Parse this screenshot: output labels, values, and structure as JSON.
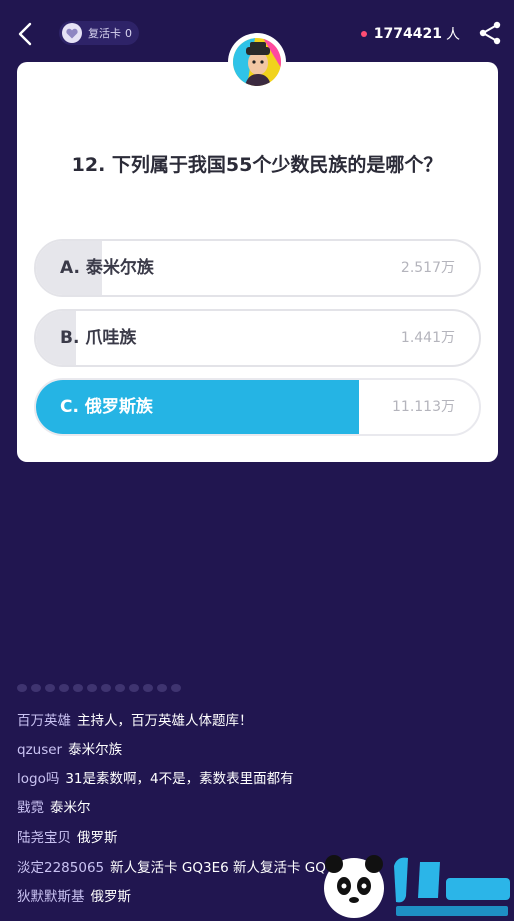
{
  "header": {
    "revive_label": "复活卡",
    "revive_count": "0",
    "online_count": "1774421",
    "online_unit": "人",
    "icons": {
      "back": "back-arrow-icon",
      "heart": "heart-icon",
      "share": "share-icon"
    }
  },
  "question": {
    "text": "12. 下列属于我国55个少数民族的是哪个？"
  },
  "options": [
    {
      "label": "A. 泰米尔族",
      "votes": "2.517万",
      "fill": 0.15,
      "selected": false
    },
    {
      "label": "B. 爪哇族",
      "votes": "1.441万",
      "fill": 0.09,
      "selected": false
    },
    {
      "label": "C. 俄罗斯族",
      "votes": "11.113万",
      "fill": 0.73,
      "selected": true
    }
  ],
  "comments": [
    {
      "user": "百万英雄",
      "text": "主持人，百万英雄人体题库！"
    },
    {
      "user": "qzuser",
      "text": "泰米尔族"
    },
    {
      "user": "logo吗",
      "text": "31是素数啊，4不是，素数表里面都有"
    },
    {
      "user": "戥霓",
      "text": "泰米尔"
    },
    {
      "user": "陆尧宝贝",
      "text": "俄罗斯"
    },
    {
      "user": "淡定2285065",
      "text": "新人复活卡  GQ3E6  新人复活卡  GQ"
    },
    {
      "user": "狄默默斯基",
      "text": "俄罗斯"
    }
  ],
  "colors": {
    "background": "#211650",
    "card": "#ffffff",
    "selected": "#25b4e4",
    "online_dot": "#ff4d73"
  }
}
